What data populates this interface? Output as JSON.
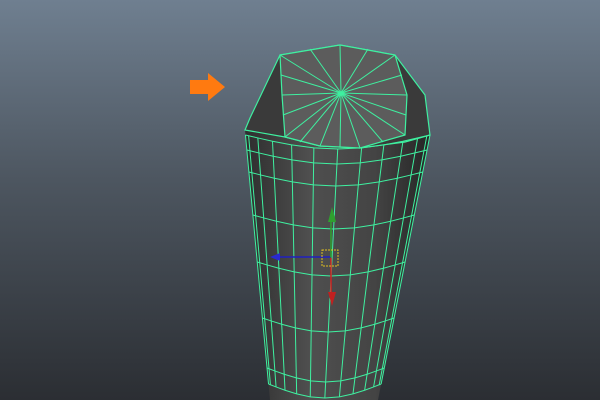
{
  "viewport": {
    "object": "polygon-cylinder",
    "colors": {
      "wireframe": "#3ff0a0",
      "surface": "#4a4a4a",
      "cap": "#5a5a5a",
      "arrow": "#ff7a10",
      "manip_y": "#2fa02f",
      "manip_x": "#d02020",
      "manip_z": "#2020c0",
      "manip_center": "#e0c020"
    }
  }
}
